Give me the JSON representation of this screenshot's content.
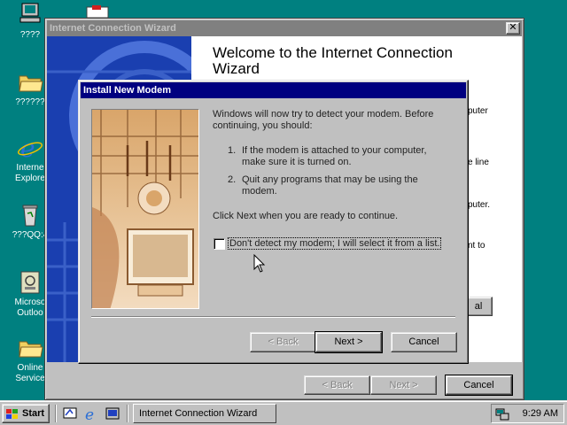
{
  "desktop": {
    "icons": [
      {
        "label": "????"
      },
      {
        "label": "??????"
      },
      {
        "label": "Interne Explore"
      },
      {
        "label": "???QQ:4"
      },
      {
        "label": "Microso Outloo"
      },
      {
        "label": "Online Service"
      }
    ]
  },
  "icw_window": {
    "title": "Internet Connection Wizard",
    "close_glyph": "✕",
    "welcome_title": "Welcome to the Internet Connection Wizard",
    "fragments": [
      "puter",
      "e line",
      "puter.",
      "nt to"
    ],
    "obscured_button_fragment": "al",
    "buttons": {
      "back": "< Back",
      "next": "Next >",
      "cancel": "Cancel"
    }
  },
  "modem_dialog": {
    "title": "Install New Modem",
    "intro": "Windows will now try to detect your modem.  Before continuing, you should:",
    "steps": [
      {
        "num": "1.",
        "text": "If the modem is attached to your computer, make sure it is turned on."
      },
      {
        "num": "2.",
        "text": "Quit any programs that may be using the modem."
      }
    ],
    "instruction": "Click Next when you are ready to continue.",
    "checkbox_label": "Don't detect my modem; I will select it from a list.",
    "checkbox_checked": false,
    "buttons": {
      "back": "< Back",
      "next": "Next >",
      "cancel": "Cancel"
    }
  },
  "taskbar": {
    "start_label": "Start",
    "task_button": "Internet Connection Wizard",
    "clock": "9:29 AM"
  },
  "colors": {
    "desktop": "#008080",
    "active_title": "#000080",
    "inactive_title": "#808080",
    "wizard_panel": "#1a3fb0"
  }
}
